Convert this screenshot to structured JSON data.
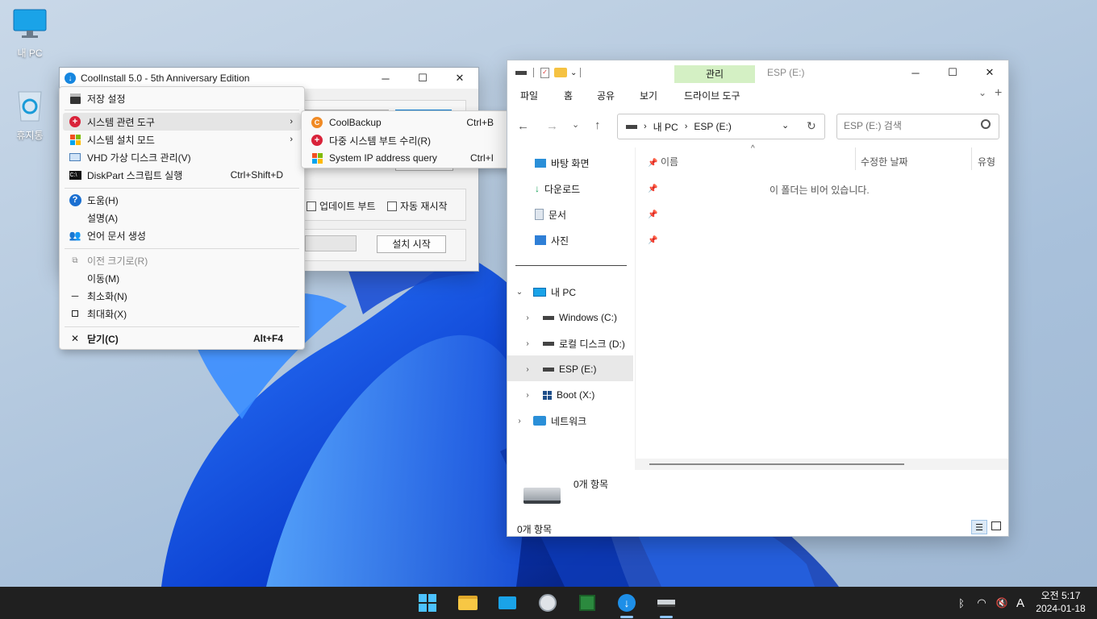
{
  "desktop": {
    "icons": [
      {
        "label": "내 PC"
      },
      {
        "label": "휴지통"
      }
    ]
  },
  "coolinstall": {
    "title": "CoolInstall 5.0 - 5th Anniversary Edition",
    "update_boot_label": "업데이트 부트",
    "auto_restart_label": "자동 재시작",
    "start_install_label": "설치 시작"
  },
  "context_menu": {
    "items": [
      {
        "label": "저장 설정",
        "shortcut": ""
      },
      {
        "label": "시스템 관련 도구",
        "shortcut": ""
      },
      {
        "label": "시스템 설치 모드",
        "shortcut": ""
      },
      {
        "label": "VHD 가상 디스크 관리(V)",
        "shortcut": ""
      },
      {
        "label": "DiskPart 스크립트 실행",
        "shortcut": "Ctrl+Shift+D"
      },
      {
        "label": "도움(H)",
        "shortcut": ""
      },
      {
        "label": "설명(A)",
        "shortcut": ""
      },
      {
        "label": "언어 문서 생성",
        "shortcut": ""
      },
      {
        "label": "이전 크기로(R)",
        "shortcut": ""
      },
      {
        "label": "이동(M)",
        "shortcut": ""
      },
      {
        "label": "최소화(N)",
        "shortcut": ""
      },
      {
        "label": "최대화(X)",
        "shortcut": ""
      },
      {
        "label": "닫기(C)",
        "shortcut": "Alt+F4"
      }
    ]
  },
  "submenu": {
    "items": [
      {
        "label": "CoolBackup",
        "shortcut": "Ctrl+B"
      },
      {
        "label": "다중 시스템 부트 수리(R)",
        "shortcut": ""
      },
      {
        "label": "System IP address query",
        "shortcut": "Ctrl+I"
      }
    ]
  },
  "explorer": {
    "context_tab": "관리",
    "title": "ESP (E:)",
    "ribbon_tabs": [
      "파일",
      "홈",
      "공유",
      "보기",
      "드라이브 도구"
    ],
    "breadcrumb": [
      "내 PC",
      "ESP (E:)"
    ],
    "search_placeholder": "ESP (E:) 검색",
    "quick_access": [
      "바탕 화면",
      "다운로드",
      "문서",
      "사진"
    ],
    "this_pc": "내 PC",
    "drives": [
      "Windows (C:)",
      "로컬 디스크 (D:)",
      "ESP (E:)",
      "Boot (X:)"
    ],
    "network": "네트워크",
    "columns": [
      "이름",
      "수정한 날짜",
      "유형"
    ],
    "empty_message": "이 폴더는 비어 있습니다.",
    "details_count": "0개 항목",
    "status_count": "0개 항목"
  },
  "taskbar": {
    "time": "오전 5:17",
    "date": "2024-01-18",
    "ime": "A"
  },
  "colors": {
    "accent": "#0078d4",
    "ribbon_context": "#d4f0c4"
  }
}
